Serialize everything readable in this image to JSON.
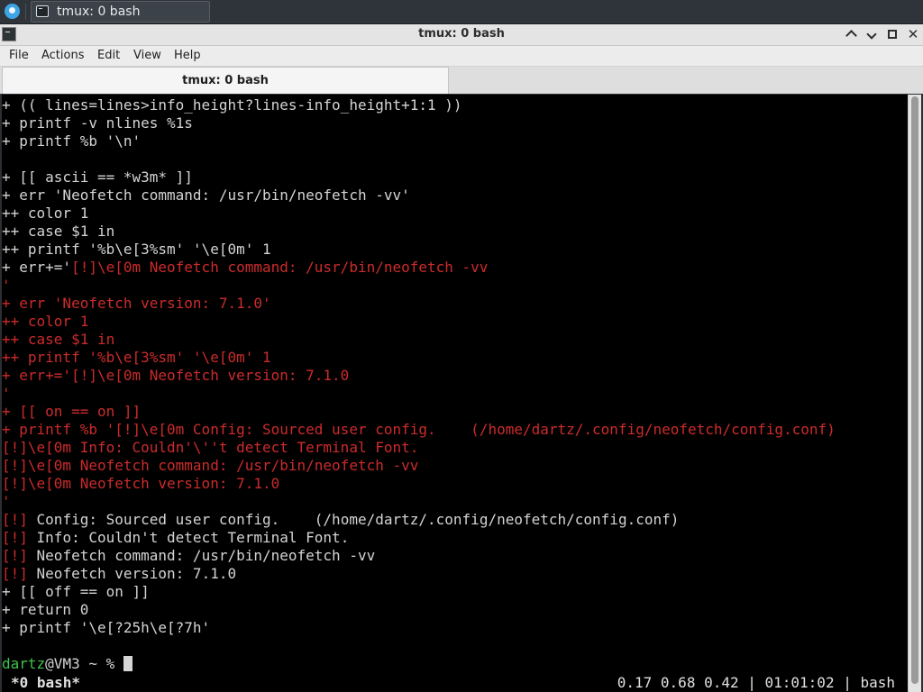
{
  "taskbar": {
    "task_label": "tmux: 0 bash",
    "start_icon": "desktop-logo-icon",
    "task_icon": "terminal-icon"
  },
  "window": {
    "title": "tmux: 0 bash",
    "icons": [
      "terminal-icon",
      "minimize-icon",
      "maximize-icon",
      "close-icon"
    ]
  },
  "menu": [
    "File",
    "Actions",
    "Edit",
    "View",
    "Help"
  ],
  "tab": {
    "label": "tmux: 0 bash"
  },
  "colors": {
    "red": "#cc2b2b",
    "green": "#3ec34b",
    "text": "#d4d4d4",
    "bg": "#000000"
  },
  "terminal": {
    "lines": [
      [
        [
          "w",
          "+ (( lines=lines>info_height?lines-info_height+1:1 ))"
        ]
      ],
      [
        [
          "w",
          "+ printf -v nlines %1s"
        ]
      ],
      [
        [
          "w",
          "+ printf %b '\\n'"
        ]
      ],
      [
        [
          "w",
          ""
        ]
      ],
      [
        [
          "w",
          "+ [[ ascii == *w3m* ]]"
        ]
      ],
      [
        [
          "w",
          "+ err 'Neofetch command: /usr/bin/neofetch -vv'"
        ]
      ],
      [
        [
          "w",
          "++ color 1"
        ]
      ],
      [
        [
          "w",
          "++ case $1 in"
        ]
      ],
      [
        [
          "w",
          "++ printf '%b\\e[3%sm' '\\e[0m' 1"
        ]
      ],
      [
        [
          "w",
          "+ err+='"
        ],
        [
          "r",
          "[!]\\e[0m Neofetch command: /usr/bin/neofetch -vv"
        ]
      ],
      [
        [
          "r",
          "'"
        ]
      ],
      [
        [
          "r",
          "+ err 'Neofetch version: 7.1.0'"
        ]
      ],
      [
        [
          "r",
          "++ color 1"
        ]
      ],
      [
        [
          "r",
          "++ case $1 in"
        ]
      ],
      [
        [
          "r",
          "++ printf '%b\\e[3%sm' '\\e[0m' 1"
        ]
      ],
      [
        [
          "r",
          "+ err+='[!]\\e[0m Neofetch version: 7.1.0"
        ]
      ],
      [
        [
          "r",
          "'"
        ]
      ],
      [
        [
          "r",
          "+ [[ on == on ]]"
        ]
      ],
      [
        [
          "r",
          "+ printf %b '[!]\\e[0m Config: Sourced user config.    (/home/dartz/.config/neofetch/config.conf)"
        ]
      ],
      [
        [
          "r",
          "[!]\\e[0m Info: Couldn'\\''t detect Terminal Font."
        ]
      ],
      [
        [
          "r",
          "[!]\\e[0m Neofetch command: /usr/bin/neofetch -vv"
        ]
      ],
      [
        [
          "r",
          "[!]\\e[0m Neofetch version: 7.1.0"
        ]
      ],
      [
        [
          "r",
          "'"
        ]
      ],
      [
        [
          "r",
          "[!]"
        ],
        [
          "w",
          " Config: Sourced user config.    (/home/dartz/.config/neofetch/config.conf)"
        ]
      ],
      [
        [
          "r",
          "[!]"
        ],
        [
          "w",
          " Info: Couldn't detect Terminal Font."
        ]
      ],
      [
        [
          "r",
          "[!]"
        ],
        [
          "w",
          " Neofetch command: /usr/bin/neofetch -vv"
        ]
      ],
      [
        [
          "r",
          "[!]"
        ],
        [
          "w",
          " Neofetch version: 7.1.0"
        ]
      ],
      [
        [
          "w",
          "+ [[ off == on ]]"
        ]
      ],
      [
        [
          "w",
          "+ return 0"
        ]
      ],
      [
        [
          "w",
          "+ printf '\\e[?25h\\e[?7h'"
        ]
      ],
      [
        [
          "w",
          ""
        ]
      ],
      [
        [
          "g",
          "dartz"
        ],
        [
          "w",
          "@VM3 ~ % "
        ]
      ]
    ],
    "prompt_user": "dartz",
    "prompt_rest": "@VM3 ~ % ",
    "status_left": "*0 bash*",
    "status_right": "0.17 0.68 0.42 | 01:01:02 | bash"
  }
}
